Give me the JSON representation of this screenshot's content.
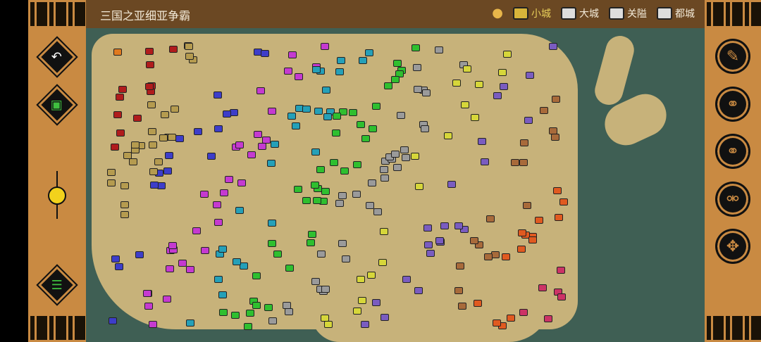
{
  "header": {
    "title": "三国之亚细亚争霸",
    "legend": [
      {
        "label": "小城",
        "color": "#d8b53a",
        "icon": "small-city-icon"
      },
      {
        "label": "大城",
        "color": "#d8d8d8",
        "icon": "large-city-icon"
      },
      {
        "label": "关隘",
        "color": "#d8d8d8",
        "icon": "pass-icon"
      },
      {
        "label": "都城",
        "color": "#d8d8d8",
        "icon": "capital-icon"
      }
    ]
  },
  "left_toolbar": {
    "back": "back-icon",
    "save": "save-icon",
    "zoom_level": 0.5,
    "menu": "list-icon"
  },
  "right_toolbar": [
    "edit-icon",
    "link-icon",
    "link-icon",
    "unlink-icon",
    "move-icon"
  ],
  "faction_colors": [
    "#e07a1f",
    "#b01c1c",
    "#b59b4f",
    "#3d3dc9",
    "#c53ad0",
    "#25a0b8",
    "#2fbf2f",
    "#9a9a9a",
    "#d6d63a",
    "#7a5cc0",
    "#a86a3a",
    "#e05a20",
    "#cc3366"
  ]
}
